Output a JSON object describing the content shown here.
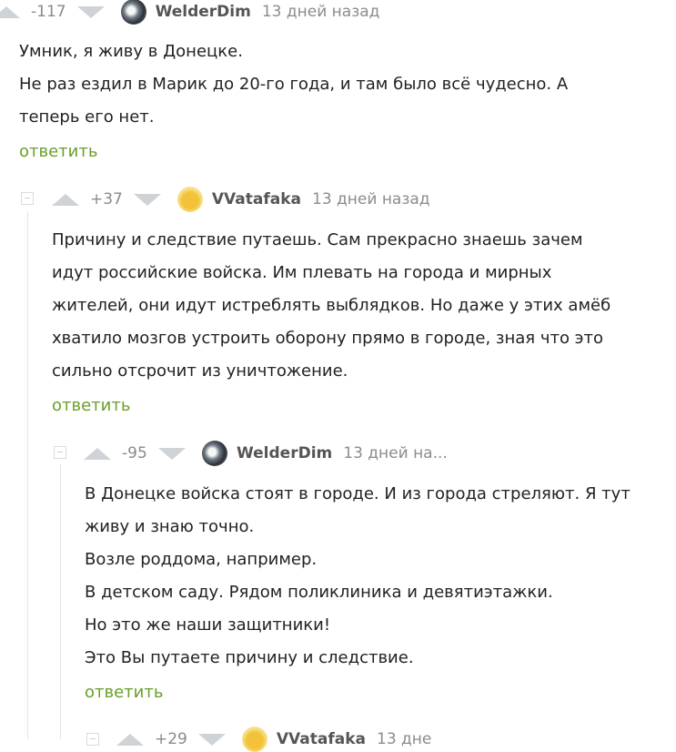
{
  "comments": [
    {
      "rating": "-117",
      "author": "WelderDim",
      "date": "13 дней назад",
      "lines": [
        "Умник, я живу в Донецке.",
        "Не раз ездил в Марик до 20-го года, и там было всё чудесно. А",
        "теперь его нет."
      ],
      "reply_label": "ответить"
    },
    {
      "rating": "+37",
      "author": "VVatafaka",
      "date": "13 дней назад",
      "lines": [
        "Причину и следствие путаешь. Сам прекрасно знаешь зачем",
        "идут российские войска. Им плевать на города и мирных",
        "жителей, они идут истреблять выблядков. Но даже у этих амёб",
        "хватило мозгов устроить оборону прямо в городе, зная что это",
        "сильно отсрочит из уничтожение."
      ],
      "reply_label": "ответить"
    },
    {
      "rating": "-95",
      "author": "WelderDim",
      "date": "13 дней на...",
      "lines": [
        "В Донецке войска стоят в городе. И из города стреляют. Я тут",
        "живу и знаю точно.",
        "Возле роддома, например.",
        "В детском саду. Рядом поликлиника и девятиэтажки.",
        "Но это же наши защитники!",
        "Это Вы путаете причину и следствие."
      ],
      "reply_label": "ответить"
    },
    {
      "rating": "+29",
      "author": "VVatafaka",
      "date": "13 дне"
    }
  ]
}
